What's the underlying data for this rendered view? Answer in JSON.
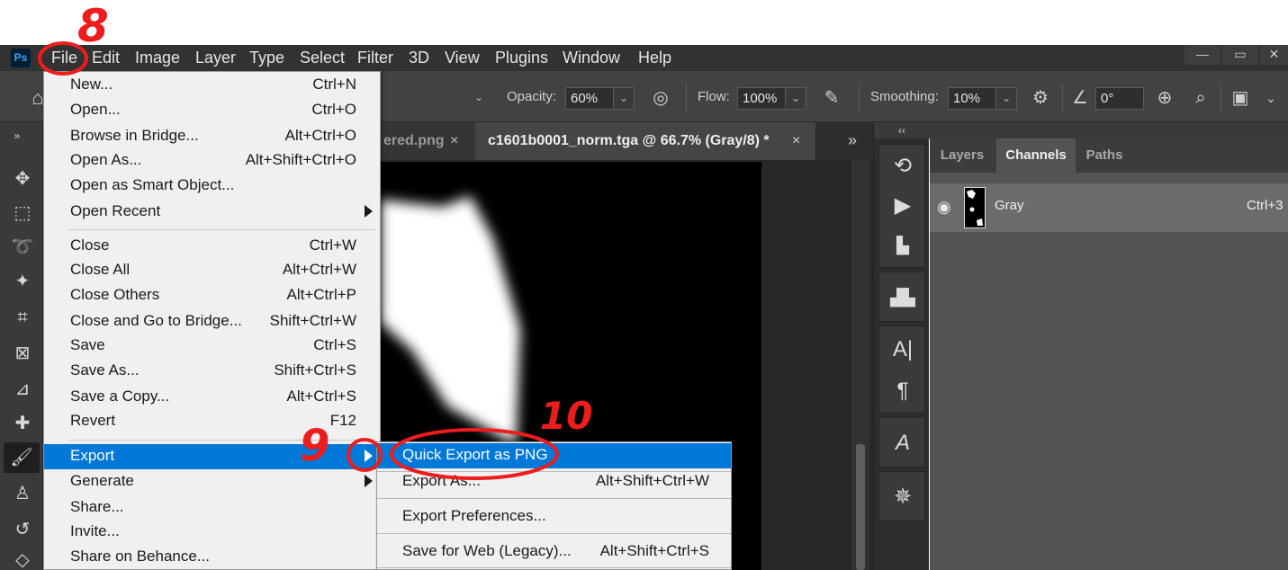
{
  "app": {
    "logo": "Ps"
  },
  "menubar": {
    "items": [
      "File",
      "Edit",
      "Image",
      "Layer",
      "Type",
      "Select",
      "Filter",
      "3D",
      "View",
      "Plugins",
      "Window",
      "Help"
    ],
    "window_controls": [
      "minimize",
      "restore",
      "close"
    ]
  },
  "options": {
    "opacity_label": "Opacity:",
    "opacity_value": "60%",
    "flow_label": "Flow:",
    "flow_value": "100%",
    "smoothing_label": "Smoothing:",
    "smoothing_value": "10%",
    "angle_value": "0°"
  },
  "tabs": {
    "prev_label": "ered.png",
    "active_label": "c1601b0001_norm.tga @ 66.7% (Gray/8) *",
    "close_glyph": "×",
    "overflow": "»"
  },
  "panel": {
    "collapse": "‹‹",
    "tabs": [
      "Layers",
      "Channels",
      "Paths"
    ],
    "active_tab": "Channels",
    "channel": {
      "name": "Gray",
      "shortcut": "Ctrl+3"
    }
  },
  "file_menu": {
    "items": [
      {
        "label": "New...",
        "shortcut": "Ctrl+N"
      },
      {
        "label": "Open...",
        "shortcut": "Ctrl+O"
      },
      {
        "label": "Browse in Bridge...",
        "shortcut": "Alt+Ctrl+O"
      },
      {
        "label": "Open As...",
        "shortcut": "Alt+Shift+Ctrl+O"
      },
      {
        "label": "Open as Smart Object...",
        "shortcut": ""
      },
      {
        "label": "Open Recent",
        "shortcut": ""
      },
      {
        "label": "Close",
        "shortcut": "Ctrl+W"
      },
      {
        "label": "Close All",
        "shortcut": "Alt+Ctrl+W"
      },
      {
        "label": "Close Others",
        "shortcut": "Alt+Ctrl+P"
      },
      {
        "label": "Close and Go to Bridge...",
        "shortcut": "Shift+Ctrl+W"
      },
      {
        "label": "Save",
        "shortcut": "Ctrl+S"
      },
      {
        "label": "Save As...",
        "shortcut": "Shift+Ctrl+S"
      },
      {
        "label": "Save a Copy...",
        "shortcut": "Alt+Ctrl+S"
      },
      {
        "label": "Revert",
        "shortcut": "F12"
      },
      {
        "label": "Export",
        "shortcut": ""
      },
      {
        "label": "Generate",
        "shortcut": ""
      },
      {
        "label": "Share...",
        "shortcut": ""
      },
      {
        "label": "Invite...",
        "shortcut": ""
      },
      {
        "label": "Share on Behance...",
        "shortcut": ""
      }
    ]
  },
  "export_submenu": {
    "items": [
      {
        "label": "Quick Export as PNG",
        "shortcut": ""
      },
      {
        "label": "Export As...",
        "shortcut": "Alt+Shift+Ctrl+W"
      },
      {
        "label": "Export Preferences...",
        "shortcut": ""
      },
      {
        "label": "Save for Web (Legacy)...",
        "shortcut": "Alt+Shift+Ctrl+S"
      }
    ]
  },
  "annotations": {
    "step_8": "8",
    "step_9": "9",
    "step_10": "10"
  },
  "colors": {
    "highlight": "#0078d7",
    "annotation": "#ee1c1c",
    "menu_bg": "#f0f0f0"
  }
}
